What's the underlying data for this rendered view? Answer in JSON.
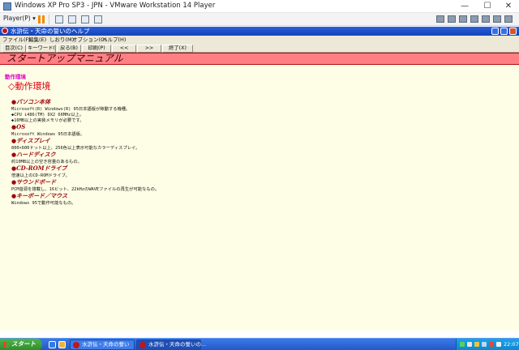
{
  "host": {
    "window_title": "Windows XP Pro SP3 - JPN - VMware Workstation 14 Player",
    "player_label": "Player(P) ▾",
    "buttons": {
      "minimize": "—",
      "maximize": "☐",
      "close": "✕"
    }
  },
  "app": {
    "window_title": "水滸伝・天命の誓いのヘルプ",
    "menu": [
      "ファイル(F)",
      "編集(E)",
      "しおり(M)",
      "オプション(O)",
      "ヘルプ(H)"
    ],
    "nav_buttons": [
      "目次(C)",
      "キーワード(I)",
      "戻る(B)",
      "印刷(P)",
      "<<",
      ">>",
      "終了(X)"
    ],
    "banner_title": "スタートアップマニュアル",
    "breadcrumb": "動作環境",
    "heading": "◇動作環境",
    "sections": [
      {
        "title": "●パソコン本体",
        "lines": [
          "Microsoft(R) Windows(R) 95日本語版が稼動する機種。",
          "◆CPU i486(TM) DX2 66MHz以上。",
          "◆16MB以上の実装メモリが必要です。"
        ]
      },
      {
        "title": "●OS",
        "lines": [
          "Microsoft Windows 95日本語版。"
        ]
      },
      {
        "title": "●ディスプレイ",
        "lines": [
          "800×600ドット以上、256色以上表示可能なカラーディスプレイ。"
        ]
      },
      {
        "title": "●ハードディスク",
        "lines": [
          "約10MB以上の空き容量のあるもの。"
        ]
      },
      {
        "title": "●CD-ROMドライブ",
        "lines": [
          "倍速以上のCD-ROMドライブ。"
        ]
      },
      {
        "title": "●サウンドボード",
        "lines": [
          "PCM音源を搭載し、16ビット、22kHzのWAVEファイルの再生が可能なもの。"
        ]
      },
      {
        "title": "●キーボード／マウス",
        "lines": [
          "Windows 95で動作可能なもの。"
        ]
      }
    ]
  },
  "taskbar": {
    "start_label": "スタート",
    "tasks": [
      {
        "label": "水滸伝・天命の誓い",
        "active": false
      },
      {
        "label": "水滸伝・天命の誓いの...",
        "active": true
      }
    ],
    "clock": "22:07"
  },
  "colors": {
    "banner": "#ff7f84",
    "content_bg": "#fefee6",
    "breadcrumb": "#e100c8",
    "heading": "#e00010",
    "section_title": "#9b0a10"
  }
}
